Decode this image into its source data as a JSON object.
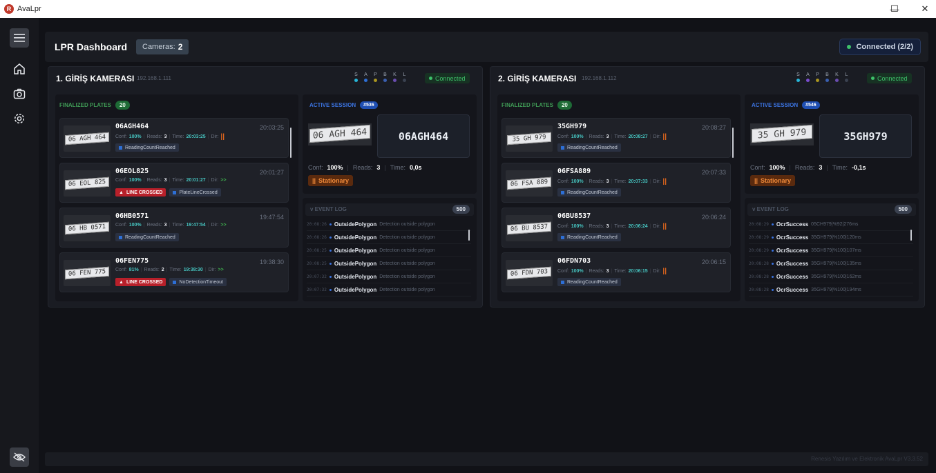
{
  "window": {
    "title": "AvaLpr",
    "app_initial": "R",
    "min": "—",
    "max": "☐",
    "close": "✕"
  },
  "header": {
    "title": "LPR Dashboard",
    "cameras_label": "Cameras:",
    "cameras_count": "2",
    "connection": "Connected (2/2)"
  },
  "indicator_letters": [
    "S",
    "A",
    "P",
    "B",
    "K",
    "L"
  ],
  "cameras": [
    {
      "title": "1. GİRİŞ KAMERASI",
      "ip": "192.168.1.111",
      "status": "Connected",
      "indicator_colors": [
        "#27b6d8",
        "#2d6fd6",
        "#a99520",
        "#3a5fb0",
        "#6a4db0",
        "#3a4150"
      ],
      "finalized_label": "FINALIZED PLATES",
      "finalized_count": "20",
      "plates": [
        {
          "number": "06AGH464",
          "time": "20:03:25",
          "conf_label": "Conf:",
          "conf": "100%",
          "reads_label": "Reads:",
          "reads": "3",
          "time_label": "Time:",
          "ptime": "20:03:25",
          "dir_label": "Dir:",
          "dir": "||",
          "dir_type": "bars",
          "img": "06 AGH 464",
          "crossed": "",
          "reason": "ReadingCountReached"
        },
        {
          "number": "06EOL825",
          "time": "20:01:27",
          "conf_label": "Conf:",
          "conf": "100%",
          "reads_label": "Reads:",
          "reads": "3",
          "time_label": "Time:",
          "ptime": "20:01:27",
          "dir_label": "Dir:",
          "dir": ">>",
          "dir_type": "arrow",
          "img": "06 EOL 825",
          "crossed": "LINE CROSSED",
          "reason": "PlateLineCrossed"
        },
        {
          "number": "06HB0571",
          "time": "19:47:54",
          "conf_label": "Conf:",
          "conf": "100%",
          "reads_label": "Reads:",
          "reads": "3",
          "time_label": "Time:",
          "ptime": "19:47:54",
          "dir_label": "Dir:",
          "dir": ">>",
          "dir_type": "arrow",
          "img": "06 HB 0571",
          "crossed": "",
          "reason": "ReadingCountReached"
        },
        {
          "number": "06FEN775",
          "time": "19:38:30",
          "conf_label": "Conf:",
          "conf": "81%",
          "reads_label": "Reads:",
          "reads": "2",
          "time_label": "Time:",
          "ptime": "19:38:30",
          "dir_label": "Dir:",
          "dir": ">>",
          "dir_type": "arrow",
          "img": "06 FEN 775",
          "crossed": "LINE CROSSED",
          "reason": "NoDetectionTimeout"
        }
      ],
      "active_label": "ACTIVE SESSION",
      "active_id": "#536",
      "active_plate": "06AGH464",
      "active_img": "06 AGH 464",
      "active_conf_label": "Conf:",
      "active_conf": "100%",
      "active_reads_label": "Reads:",
      "active_reads": "3",
      "active_time_label": "Time:",
      "active_time": "0,0s",
      "state": "Stationary",
      "log_label": "EVENT LOG",
      "log_count": "500",
      "events": [
        {
          "ts": "20:08:26",
          "event": "OutsidePolygon",
          "msg": "Detection outside polygon"
        },
        {
          "ts": "20:08:26",
          "event": "OutsidePolygon",
          "msg": "Detection outside polygon"
        },
        {
          "ts": "20:08:25",
          "event": "OutsidePolygon",
          "msg": "Detection outside polygon"
        },
        {
          "ts": "20:08:25",
          "event": "OutsidePolygon",
          "msg": "Detection outside polygon"
        },
        {
          "ts": "20:07:32",
          "event": "OutsidePolygon",
          "msg": "Detection outside polygon"
        },
        {
          "ts": "20:07:32",
          "event": "OutsidePolygon",
          "msg": "Detection outside polygon"
        }
      ]
    },
    {
      "title": "2. GİRİŞ KAMERASI",
      "ip": "192.168.1.112",
      "status": "Connected",
      "indicator_colors": [
        "#27b6d8",
        "#7a4dd0",
        "#a99520",
        "#3a5fb0",
        "#6a4db0",
        "#3a4150"
      ],
      "finalized_label": "FINALIZED PLATES",
      "finalized_count": "20",
      "plates": [
        {
          "number": "35GH979",
          "time": "20:08:27",
          "conf_label": "Conf:",
          "conf": "100%",
          "reads_label": "Reads:",
          "reads": "3",
          "time_label": "Time:",
          "ptime": "20:08:27",
          "dir_label": "Dir:",
          "dir": "||",
          "dir_type": "bars",
          "img": "35 GH 979",
          "crossed": "",
          "reason": "ReadingCountReached"
        },
        {
          "number": "06FSA889",
          "time": "20:07:33",
          "conf_label": "Conf:",
          "conf": "100%",
          "reads_label": "Reads:",
          "reads": "3",
          "time_label": "Time:",
          "ptime": "20:07:33",
          "dir_label": "Dir:",
          "dir": "||",
          "dir_type": "bars",
          "img": "06 FSA 889",
          "crossed": "",
          "reason": "ReadingCountReached"
        },
        {
          "number": "06BU8537",
          "time": "20:06:24",
          "conf_label": "Conf:",
          "conf": "100%",
          "reads_label": "Reads:",
          "reads": "3",
          "time_label": "Time:",
          "ptime": "20:06:24",
          "dir_label": "Dir:",
          "dir": "||",
          "dir_type": "bars",
          "img": "06 BU 8537",
          "crossed": "",
          "reason": "ReadingCountReached"
        },
        {
          "number": "06FDN703",
          "time": "20:06:15",
          "conf_label": "Conf:",
          "conf": "100%",
          "reads_label": "Reads:",
          "reads": "3",
          "time_label": "Time:",
          "ptime": "20:06:15",
          "dir_label": "Dir:",
          "dir": "||",
          "dir_type": "bars",
          "img": "06 FDN 703",
          "crossed": "",
          "reason": "ReadingCountReached"
        }
      ],
      "active_label": "ACTIVE SESSION",
      "active_id": "#546",
      "active_plate": "35GH979",
      "active_img": "35 GH 979",
      "active_conf_label": "Conf:",
      "active_conf": "100%",
      "active_reads_label": "Reads:",
      "active_reads": "3",
      "active_time_label": "Time:",
      "active_time": "-0,1s",
      "state": "Stationary",
      "log_label": "EVENT LOG",
      "log_count": "500",
      "events": [
        {
          "ts": "20:08:29",
          "event": "OcrSuccess",
          "msg": "05CH979|%92|276ms"
        },
        {
          "ts": "20:08:29",
          "event": "OcrSuccess",
          "msg": "35GH979|%100|120ms"
        },
        {
          "ts": "20:08:29",
          "event": "OcrSuccess",
          "msg": "35GH979|%100|107ms"
        },
        {
          "ts": "20:08:28",
          "event": "OcrSuccess",
          "msg": "35GH979|%100|135ms"
        },
        {
          "ts": "20:08:28",
          "event": "OcrSuccess",
          "msg": "35GH979|%100|162ms"
        },
        {
          "ts": "20:08:28",
          "event": "OcrSuccess",
          "msg": "35GH979|%100|194ms"
        }
      ]
    }
  ],
  "footer": {
    "text": "Renesis Yazılım ve Elektronik AvaLpr V3.3.52"
  },
  "colors": {
    "accent": "#3b73e0",
    "connected": "#3ec16a",
    "warning": "#e0651d",
    "danger": "#b8202a"
  }
}
